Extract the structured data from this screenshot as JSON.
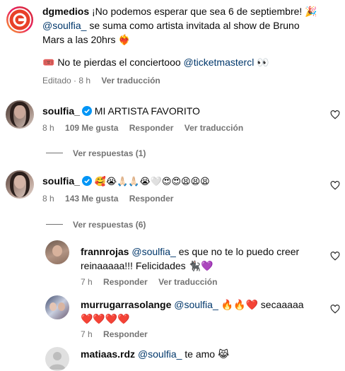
{
  "caption": {
    "username": "dgmedios",
    "line1": "¡No podemos esperar que sea 6 de septiembre! 🎉",
    "mention1": "@soulfia_",
    "line2_rest": " se suma como artista invitada al show de Bruno",
    "line3": "Mars a las 20hrs ❤️‍🔥",
    "line4_prefix": "🎟️ No te pierdas el conciertooo ",
    "mention2": "@ticketmastercl",
    "line4_suffix": " 👀",
    "edited": "Editado · 8 h",
    "translate": "Ver traducción"
  },
  "comments": [
    {
      "username": "soulfia_",
      "text": "MI ARTISTA FAVORITO",
      "time": "8 h",
      "likes": "109 Me gusta",
      "reply": "Responder",
      "translate": "Ver traducción",
      "view_replies": "Ver respuestas (1)"
    },
    {
      "username": "soulfia_",
      "text": "🥰😭🙏🏻🙏🏻😭🤍😍😍😫😫😫",
      "time": "8 h",
      "likes": "143 Me gusta",
      "reply": "Responder",
      "view_replies": "Ver respuestas (6)"
    }
  ],
  "replies": [
    {
      "username": "frannrojas",
      "mention": "@soulfia_",
      "text1": " es que no te lo puedo creer",
      "text2": "reinaaaaa!!! Felicidades 🐈‍⬛💜",
      "time": "7 h",
      "reply": "Responder",
      "translate": "Ver traducción"
    },
    {
      "username": "murrugarrasolange",
      "mention": "@soulfia_",
      "text1": " 🔥🔥❤️ secaaaaa",
      "text2": "❤️❤️❤️❤️",
      "time": "7 h",
      "reply": "Responder"
    },
    {
      "username": "matiaas.rdz",
      "mention": "@soulfia_",
      "text1": " te amo 😹"
    }
  ],
  "colors": {
    "mention": "#00376b",
    "meta": "#737373",
    "verified": "#0095f6",
    "heart": "#262626"
  }
}
